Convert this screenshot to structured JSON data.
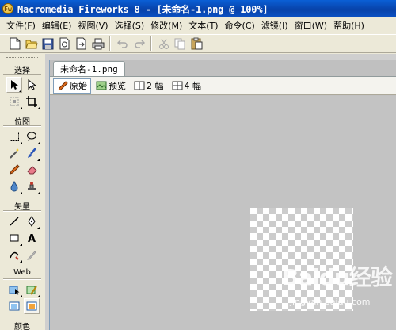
{
  "window": {
    "title": "Macromedia Fireworks 8 - [未命名-1.png @ 100%]",
    "app_icon": "fireworks-icon"
  },
  "menu": [
    "文件(F)",
    "编辑(E)",
    "视图(V)",
    "选择(S)",
    "修改(M)",
    "文本(T)",
    "命令(C)",
    "滤镜(I)",
    "窗口(W)",
    "帮助(H)"
  ],
  "toolbar": {
    "icons": [
      "new-document-icon",
      "open-folder-icon",
      "save-icon",
      "import-icon",
      "export-icon",
      "print-icon",
      "undo-icon",
      "redo-icon",
      "cut-icon",
      "copy-icon",
      "paste-icon"
    ]
  },
  "tools": {
    "sections": {
      "select": "选择",
      "bitmap": "位图",
      "vector": "矢量",
      "web": "Web",
      "colors": "颜色"
    }
  },
  "document": {
    "tab": "未命名-1.png",
    "views": {
      "original": "原始",
      "preview": "预览",
      "two_up": "2 幅",
      "four_up": "4 幅"
    },
    "active_view": "original"
  },
  "watermark": {
    "brand": "Baidu经验",
    "url": "jingyan.baidu.com"
  }
}
